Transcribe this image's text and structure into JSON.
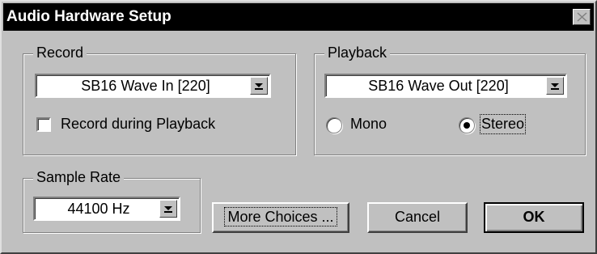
{
  "window": {
    "title": "Audio Hardware Setup",
    "close_icon": "close-icon"
  },
  "record": {
    "label": "Record",
    "device": "SB16 Wave In [220]",
    "record_during_playback_label": "Record during Playback",
    "record_during_playback_checked": false
  },
  "playback": {
    "label": "Playback",
    "device": "SB16 Wave Out [220]",
    "mono_label": "Mono",
    "stereo_label": "Stereo",
    "selected_mode": "Stereo"
  },
  "sample_rate": {
    "label": "Sample Rate",
    "value": "44100 Hz"
  },
  "buttons": {
    "more_choices": "More Choices ...",
    "cancel": "Cancel",
    "ok": "OK"
  },
  "colors": {
    "face": "#c0c0c0",
    "titlebar": "#000000",
    "title_text": "#ffffff"
  }
}
